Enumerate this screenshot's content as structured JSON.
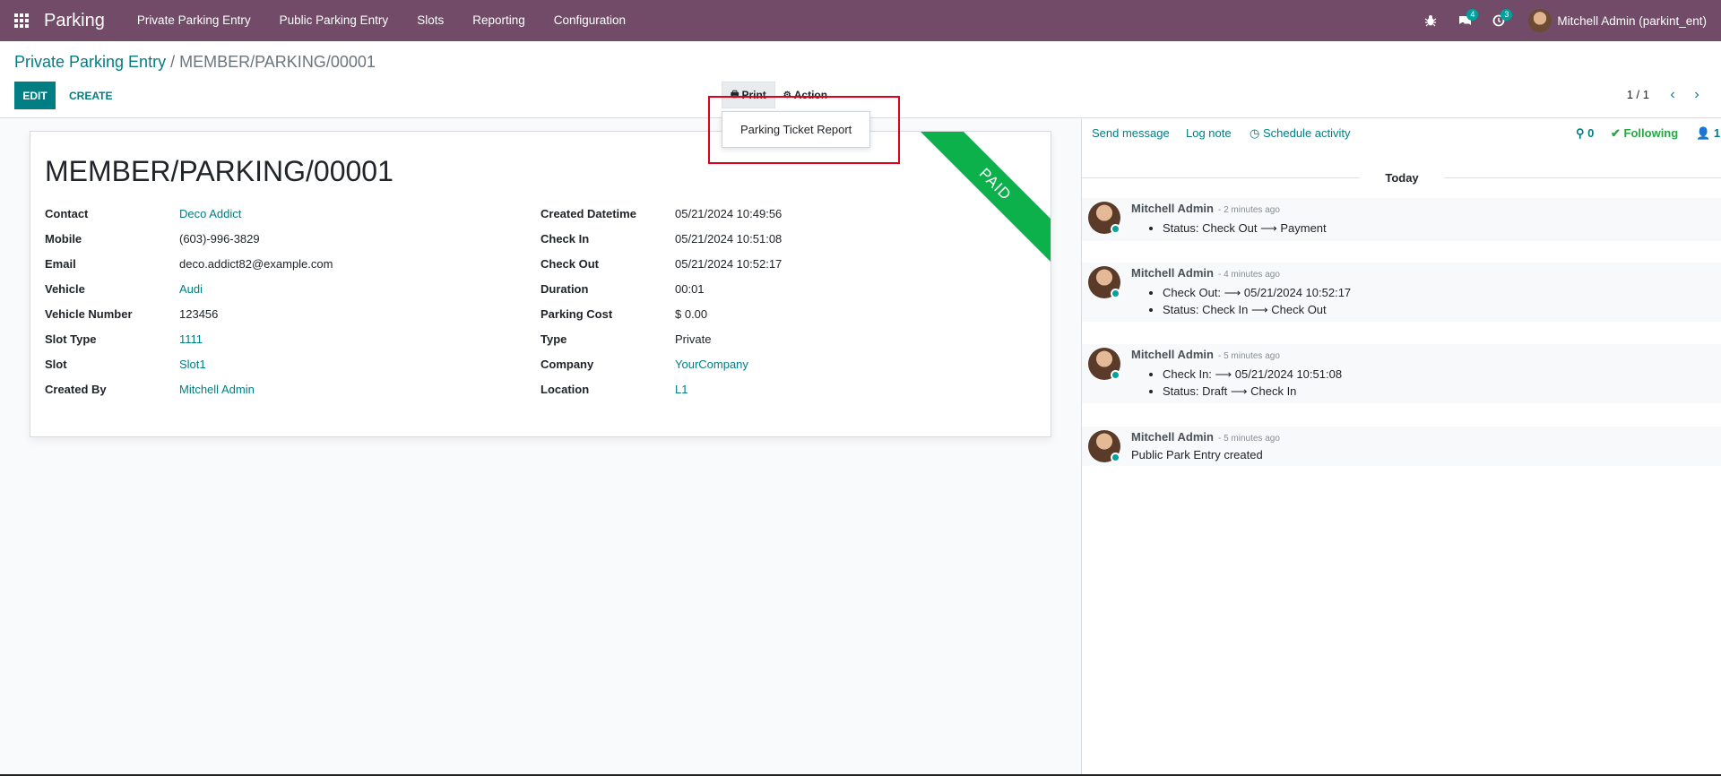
{
  "navbar": {
    "brand": "Parking",
    "menu": [
      "Private Parking Entry",
      "Public Parking Entry",
      "Slots",
      "Reporting",
      "Configuration"
    ],
    "messages_badge": "4",
    "activities_badge": "3",
    "user_name": "Mitchell Admin (parkint_ent)"
  },
  "breadcrumb": {
    "parent": "Private Parking Entry",
    "separator": "/",
    "current": "MEMBER/PARKING/00001"
  },
  "toolbar": {
    "edit_label": "EDIT",
    "create_label": "CREATE",
    "print_label": "Print",
    "action_label": "Action",
    "pager": "1 / 1"
  },
  "print_dropdown": {
    "items": [
      "Parking Ticket Report"
    ]
  },
  "record": {
    "title": "MEMBER/PARKING/00001",
    "ribbon": "PAID",
    "left_fields": [
      {
        "label": "Contact",
        "value": "Deco Addict",
        "link": true
      },
      {
        "label": "Mobile",
        "value": "(603)-996-3829",
        "link": false
      },
      {
        "label": "Email",
        "value": "deco.addict82@example.com",
        "link": false
      },
      {
        "label": "Vehicle",
        "value": "Audi",
        "link": true
      },
      {
        "label": "Vehicle Number",
        "value": "123456",
        "link": false
      },
      {
        "label": "Slot Type",
        "value": "1111",
        "link": true
      },
      {
        "label": "Slot",
        "value": "Slot1",
        "link": true
      },
      {
        "label": "Created By",
        "value": "Mitchell Admin",
        "link": true
      }
    ],
    "right_fields": [
      {
        "label": "Created Datetime",
        "value": "05/21/2024 10:49:56",
        "link": false
      },
      {
        "label": "Check In",
        "value": "05/21/2024 10:51:08",
        "link": false
      },
      {
        "label": "Check Out",
        "value": "05/21/2024 10:52:17",
        "link": false
      },
      {
        "label": "Duration",
        "value": "00:01",
        "link": false
      },
      {
        "label": "Parking Cost",
        "value": "$ 0.00",
        "link": false
      },
      {
        "label": "Type",
        "value": "Private",
        "link": false
      },
      {
        "label": "Company",
        "value": "YourCompany",
        "link": true
      },
      {
        "label": "Location",
        "value": "L1",
        "link": true
      }
    ]
  },
  "chatter": {
    "send_message": "Send message",
    "log_note": "Log note",
    "schedule_activity": "Schedule activity",
    "attachments_count": "0",
    "following": "Following",
    "followers_count": "1",
    "date_separator": "Today",
    "messages": [
      {
        "author": "Mitchell Admin",
        "date": "- 2 minutes ago",
        "lines": [
          "Status: Check Out ⟶ Payment"
        ]
      },
      {
        "author": "Mitchell Admin",
        "date": "- 4 minutes ago",
        "lines": [
          "Check Out: ⟶ 05/21/2024 10:52:17",
          "Status: Check In ⟶ Check Out"
        ]
      },
      {
        "author": "Mitchell Admin",
        "date": "- 5 minutes ago",
        "lines": [
          "Check In: ⟶ 05/21/2024 10:51:08",
          "Status: Draft ⟶ Check In"
        ]
      },
      {
        "author": "Mitchell Admin",
        "date": "- 5 minutes ago",
        "body": "Public Park Entry created"
      }
    ]
  },
  "colors": {
    "navbar": "#714b67",
    "primary": "#017e84",
    "ribbon": "#0cb14b",
    "following": "#28a745",
    "highlight": "#e0001b"
  }
}
